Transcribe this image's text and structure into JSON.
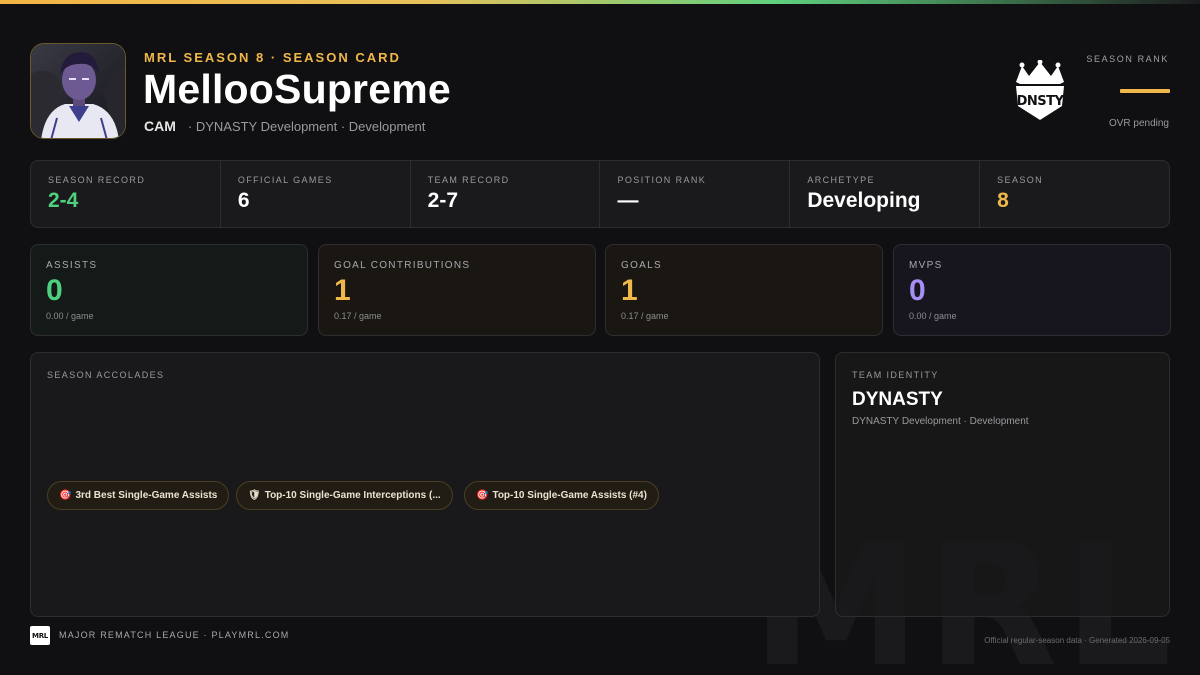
{
  "header": {
    "eyebrow": "MRL SEASON 8 · SEASON CARD",
    "player_name": "MellooSupreme",
    "position": "CAM",
    "team_line": "· DYNASTY Development · Development",
    "team_logo_text": "DNSTY",
    "season_rank_label": "SEASON RANK",
    "season_rank_note": "OVR pending"
  },
  "info_strip": [
    {
      "label": "SEASON RECORD",
      "value": "2-4",
      "color": "#4fd07f"
    },
    {
      "label": "OFFICIAL GAMES",
      "value": "6",
      "color": "#ffffff"
    },
    {
      "label": "TEAM RECORD",
      "value": "2-7",
      "color": "#ffffff"
    },
    {
      "label": "POSITION RANK",
      "value": "—",
      "color": "#ffffff"
    },
    {
      "label": "ARCHETYPE",
      "value": "Developing",
      "color": "#ffffff"
    },
    {
      "label": "SEASON",
      "value": "8",
      "color": "#f0b84a"
    }
  ],
  "stats": [
    {
      "label": "ASSISTS",
      "value": "0",
      "rate": "0.00 / game",
      "color": "#4fd07f",
      "bg": "#131a17"
    },
    {
      "label": "GOAL CONTRIBUTIONS",
      "value": "1",
      "rate": "0.17 / game",
      "color": "#f0b84a",
      "bg": "#1a1712"
    },
    {
      "label": "GOALS",
      "value": "1",
      "rate": "0.17 / game",
      "color": "#f0b84a",
      "bg": "#1a1712"
    },
    {
      "label": "MVPS",
      "value": "0",
      "rate": "0.00 / game",
      "color": "#a68ef5",
      "bg": "#17161e"
    }
  ],
  "accolades": {
    "label": "SEASON ACCOLADES",
    "items": [
      {
        "icon": "🎯",
        "text": "3rd Best Single-Game Assists",
        "icon_name": "target-icon"
      },
      {
        "icon": "🛡",
        "text": "Top-10 Single-Game Interceptions (...",
        "icon_name": "shield-icon"
      },
      {
        "icon": "🎯",
        "text": "Top-10 Single-Game Assists (#4)",
        "icon_name": "target-icon"
      }
    ]
  },
  "team_identity": {
    "label": "TEAM IDENTITY",
    "name": "DYNASTY",
    "sub": "DYNASTY Development · Development"
  },
  "footer": {
    "logo_text": "MRL",
    "text": "MAJOR REMATCH LEAGUE · PLAYMRL.COM",
    "note": "Official regular-season data · Generated 2026-09-05",
    "watermark": "MRL"
  }
}
